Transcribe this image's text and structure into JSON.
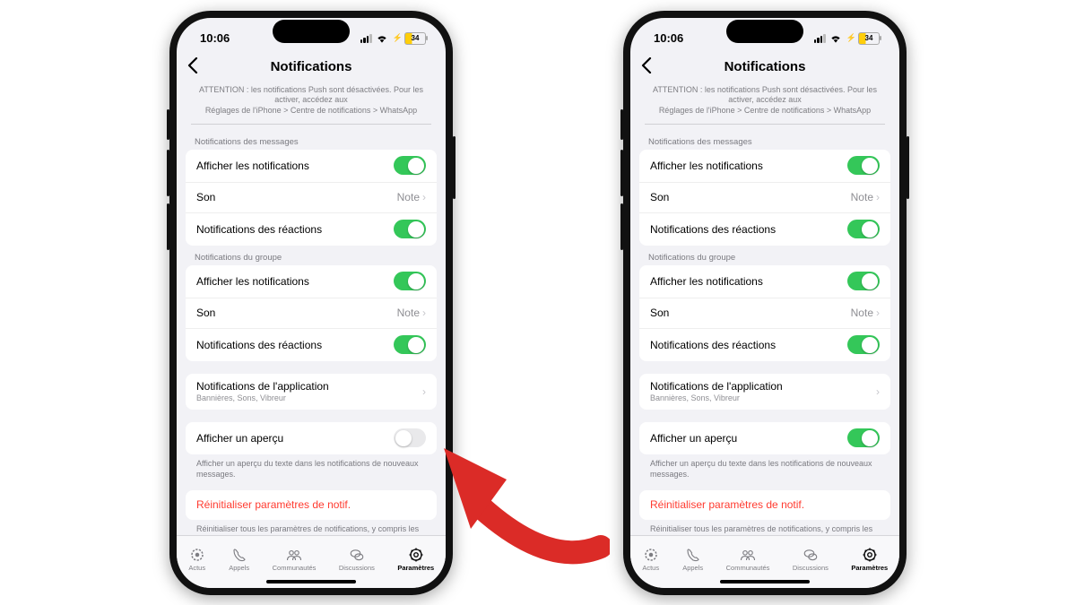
{
  "status": {
    "time": "10:06",
    "battery": "34"
  },
  "header": {
    "title": "Notifications"
  },
  "warning": {
    "line1": "ATTENTION : les notifications Push sont désactivées. Pour les activer, accédez aux",
    "line2": "Réglages de l'iPhone > Centre de notifications > WhatsApp"
  },
  "sections": {
    "messages": {
      "header": "Notifications des messages",
      "show": "Afficher les notifications",
      "sound_label": "Son",
      "sound_value": "Note",
      "reactions": "Notifications des réactions"
    },
    "group": {
      "header": "Notifications du groupe",
      "show": "Afficher les notifications",
      "sound_label": "Son",
      "sound_value": "Note",
      "reactions": "Notifications des réactions"
    },
    "app": {
      "title": "Notifications de l'application",
      "subtitle": "Bannières, Sons, Vibreur"
    },
    "preview": {
      "label": "Afficher un aperçu",
      "footer": "Afficher un aperçu du texte dans les notifications de nouveaux messages."
    },
    "reset": {
      "label": "Réinitialiser paramètres de notif.",
      "footer": "Réinitialiser tous les paramètres de notifications, y compris les notifications personnalisées pour vos discussions"
    }
  },
  "tabs": {
    "actus": "Actus",
    "appels": "Appels",
    "communautes": "Communautés",
    "discussions": "Discussions",
    "parametres": "Paramètres"
  }
}
